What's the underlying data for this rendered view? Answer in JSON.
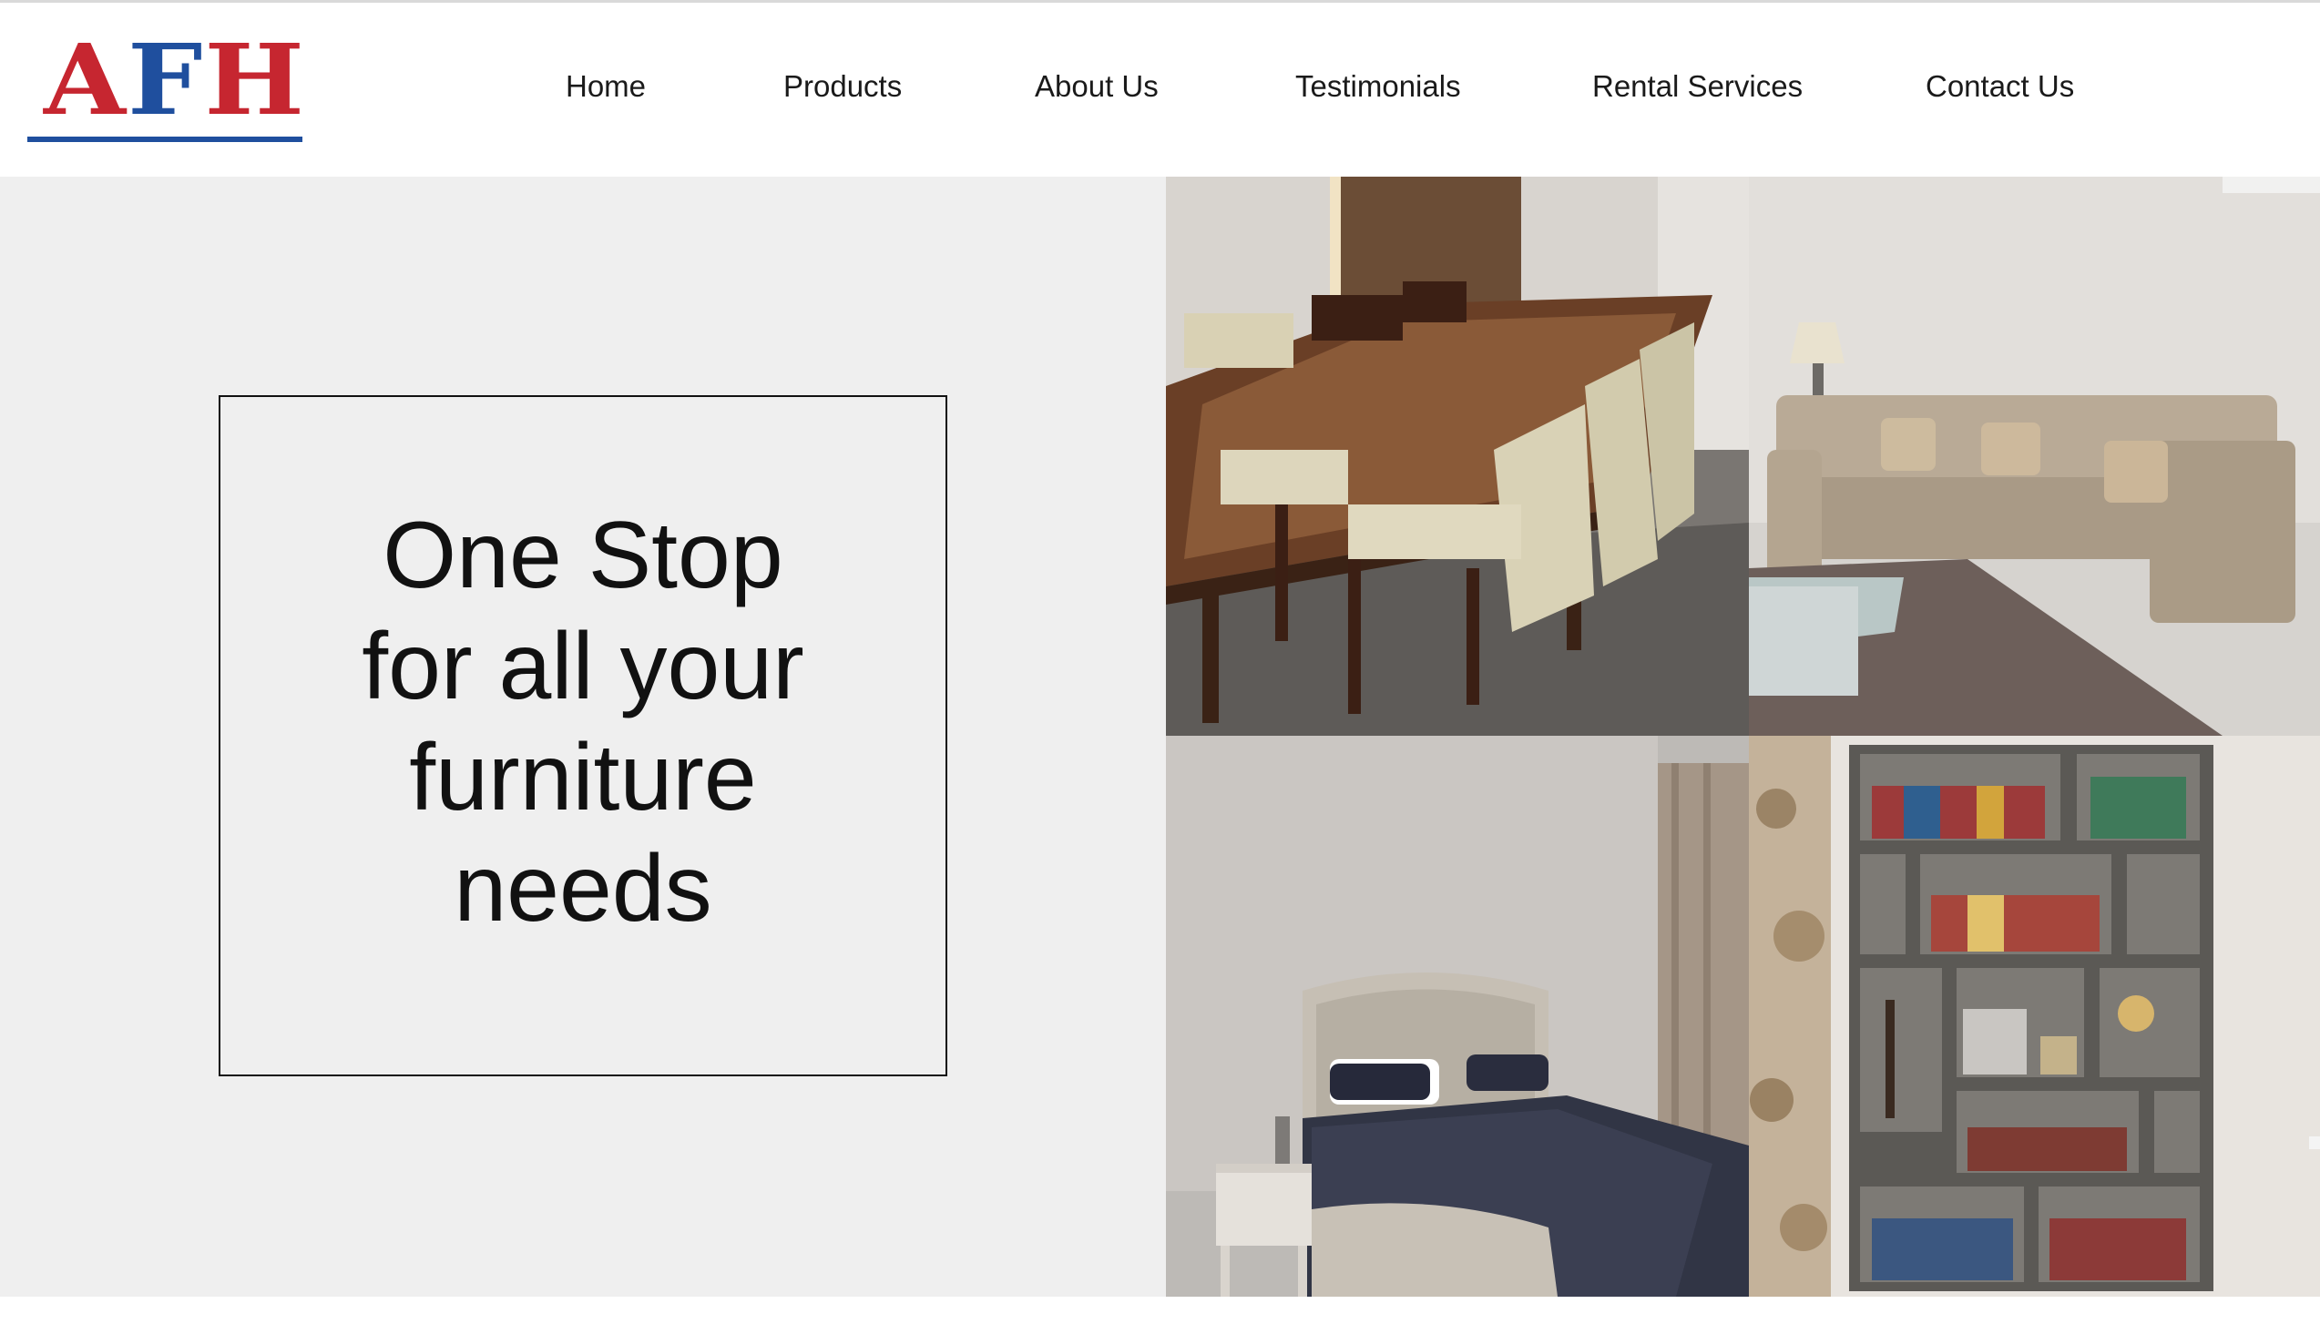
{
  "brand": {
    "logo_letters": [
      "A",
      "F",
      "H"
    ],
    "colors": {
      "red": "#c62630",
      "blue": "#1f4f9e"
    }
  },
  "nav": {
    "items": [
      {
        "label": "Home"
      },
      {
        "label": "Products"
      },
      {
        "label": "About Us"
      },
      {
        "label": "Testimonials"
      },
      {
        "label": "Rental Services"
      },
      {
        "label": "Contact Us"
      }
    ]
  },
  "hero": {
    "line1": "One Stop",
    "line2": "for all your",
    "line3": "furniture",
    "line4": "needs"
  },
  "gallery": {
    "images": [
      {
        "subject": "dining-table-photo"
      },
      {
        "subject": "sofa-photo"
      },
      {
        "subject": "bed-photo"
      },
      {
        "subject": "bookshelf-photo"
      }
    ]
  }
}
